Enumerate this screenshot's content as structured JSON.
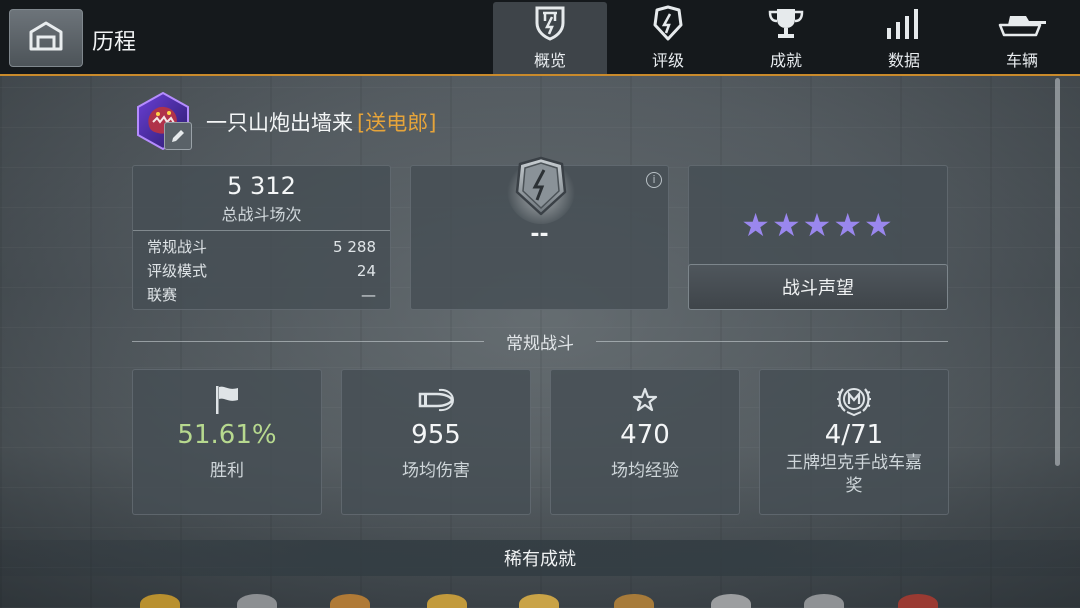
{
  "header": {
    "title": "历程",
    "tabs": [
      {
        "label": "概览",
        "icon": "overview-shield-icon",
        "active": true
      },
      {
        "label": "评级",
        "icon": "rating-shield-icon",
        "active": false
      },
      {
        "label": "成就",
        "icon": "trophy-icon",
        "active": false
      },
      {
        "label": "数据",
        "icon": "bar-stats-icon",
        "active": false
      },
      {
        "label": "车辆",
        "icon": "tank-icon",
        "active": false
      }
    ]
  },
  "player": {
    "name": "一只山炮出墙来",
    "clan": "[送电郎]"
  },
  "battles": {
    "total": "5 312",
    "total_label": "总战斗场次",
    "rows": [
      {
        "label": "常规战斗",
        "value": "5 288"
      },
      {
        "label": "评级模式",
        "value": "24"
      },
      {
        "label": "联赛",
        "value": "—"
      }
    ]
  },
  "rank": {
    "value": "--"
  },
  "reputation": {
    "stars": "★★★★★",
    "button_label": "战斗声望"
  },
  "regular": {
    "section_title": "常规战斗",
    "stats": [
      {
        "value": "51.61%",
        "label": "胜利",
        "icon": "flag-icon"
      },
      {
        "value": "955",
        "label": "场均伤害",
        "icon": "shell-icon"
      },
      {
        "value": "470",
        "label": "场均经验",
        "icon": "star-outline-icon"
      },
      {
        "value": "4/71",
        "label": "王牌坦克手战车嘉奖",
        "icon": "mastery-badge-icon"
      }
    ]
  },
  "rare": {
    "title": "稀有成就"
  },
  "colors": {
    "accent": "#c98a2b",
    "clan": "#e6a43a",
    "win_rate": "#b7d98f",
    "stars": "#9a87ee"
  }
}
